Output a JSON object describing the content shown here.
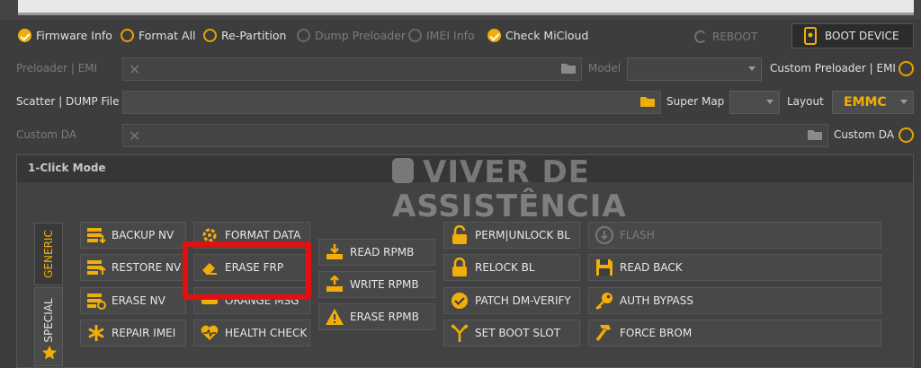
{
  "options": [
    {
      "label": "Firmware Info",
      "checked": true,
      "enabled": true
    },
    {
      "label": "Format All",
      "checked": false,
      "enabled": true
    },
    {
      "label": "Re-Partition",
      "checked": false,
      "enabled": true
    },
    {
      "label": "Dump Preloader",
      "checked": false,
      "enabled": false
    },
    {
      "label": "IMEI Info",
      "checked": false,
      "enabled": false
    },
    {
      "label": "Check MiCloud",
      "checked": true,
      "enabled": true
    }
  ],
  "reboot_label": "REBOOT",
  "boot_device_label": "BOOT DEVICE",
  "fields": {
    "preloader_label": "Preloader | EMI",
    "model_label": "Model",
    "custom_preloader_label": "Custom Preloader | EMI",
    "scatter_label": "Scatter | DUMP File",
    "super_map_label": "Super Map",
    "layout_label": "Layout",
    "layout_value": "EMMC",
    "custom_da_field_label": "Custom DA",
    "custom_da_label": "Custom DA"
  },
  "panel_title": "1-Click Mode",
  "tabs": {
    "generic": "GENERIC",
    "special": "SPECIAL"
  },
  "watermark": {
    "line1": "VIVER DE",
    "line2": "ASSISTÊNCIA"
  },
  "buttons": {
    "backup_nv": "BACKUP NV",
    "restore_nv": "RESTORE NV",
    "erase_nv": "ERASE NV",
    "repair_imei": "REPAIR IMEI",
    "format_data": "FORMAT DATA",
    "erase_frp": "ERASE FRP",
    "orange_msg": "ORANGE MSG",
    "health_check": "HEALTH CHECK",
    "read_rpmb": "READ RPMB",
    "write_rpmb": "WRITE RPMB",
    "erase_rpmb": "ERASE RPMB",
    "perm_unlock_bl": "PERM|UNLOCK BL",
    "relock_bl": "RELOCK BL",
    "patch_dm_verify": "PATCH DM-VERIFY",
    "set_boot_slot": "SET BOOT SLOT",
    "flash": "FLASH",
    "read_back": "READ BACK",
    "auth_bypass": "AUTH BYPASS",
    "force_brom": "FORCE BROM"
  },
  "icons": {
    "accent_color": "#f2ae08",
    "highlight_color": "#e21010"
  }
}
